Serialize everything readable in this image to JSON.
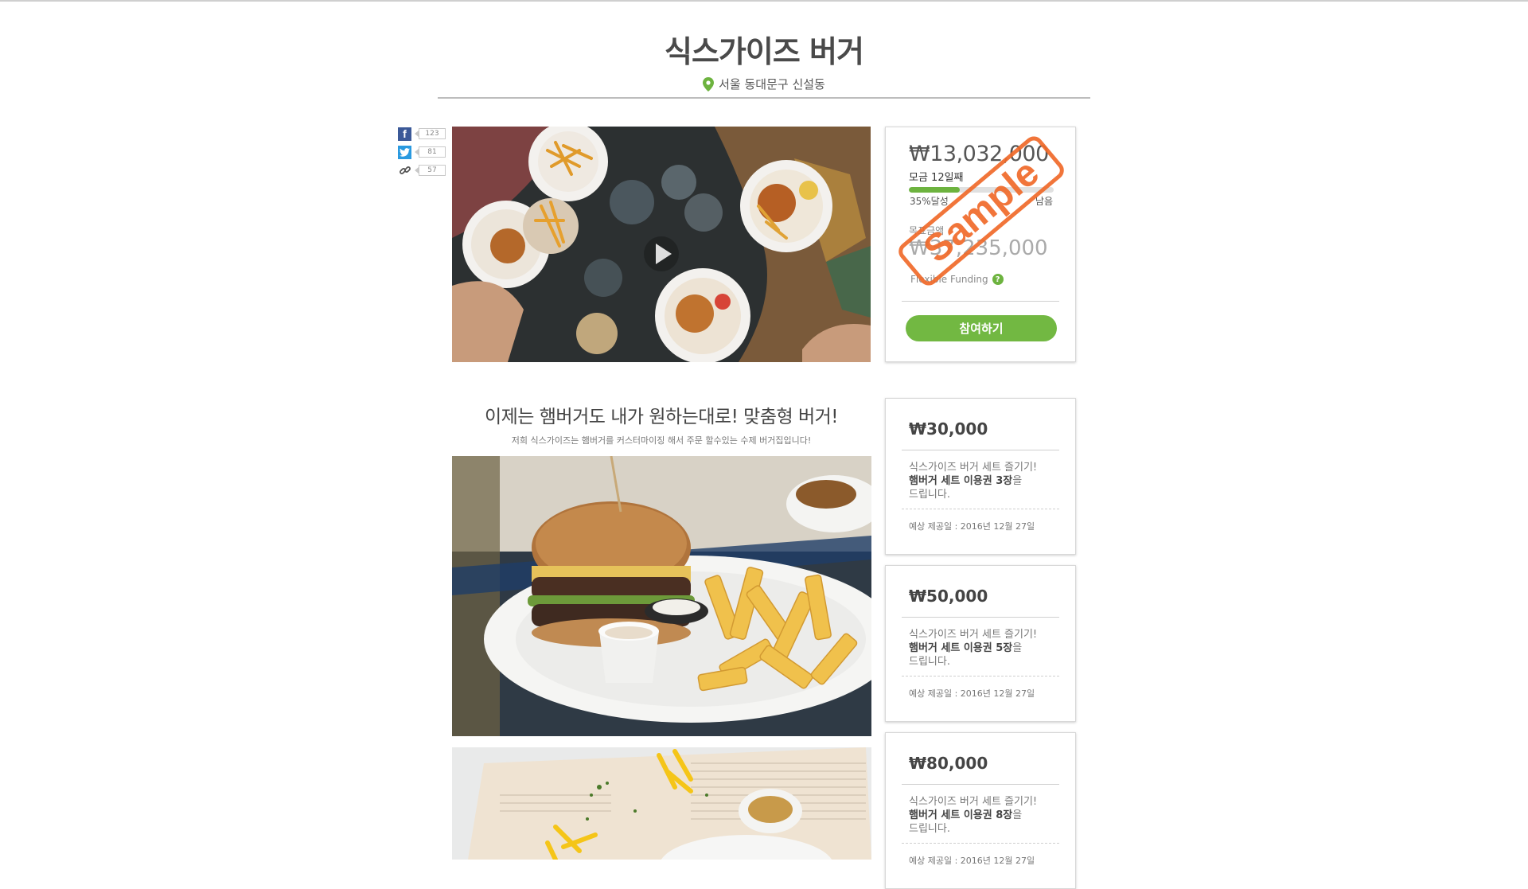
{
  "project": {
    "title": "식스가이즈 버거",
    "location": "서울 동대문구 신설동"
  },
  "social": [
    {
      "icon": "facebook-icon",
      "count": "123"
    },
    {
      "icon": "twitter-icon",
      "count": "81"
    },
    {
      "icon": "link-icon",
      "count": "57"
    }
  ],
  "funding": {
    "amount": "₩13,032,000",
    "days": "모금 12일째",
    "percent_label": "35%달성",
    "progress": 0.35,
    "remaining": "남음",
    "goal_label": "목표금액",
    "goal_amount": "₩37,235,000",
    "funding_type": "Flexible Funding",
    "help_icon": "question-icon",
    "join_label": "참여하기",
    "stamp": "Sample",
    "accent": "#6db33f",
    "stamp_color": "#f06a2a"
  },
  "content": {
    "headline": "이제는 햄버거도 내가 원하는대로! 맞춤형 버거!",
    "description": "저희 식스가이즈는 햄버거를 커스터마이징 해서 주문 할수있는 수제 버거집입니다!"
  },
  "rewards": [
    {
      "price": "₩30,000",
      "line1": "식스가이즈 버거 세트 즐기기!",
      "bold": "햄버거 세트 이용권 3장",
      "rest": "을",
      "line3": "드립니다.",
      "date": "예상 제공일 : 2016년 12월 27일"
    },
    {
      "price": "₩50,000",
      "line1": "식스가이즈 버거 세트 즐기기!",
      "bold": "햄버거 세트 이용권 5장",
      "rest": "을",
      "line3": "드립니다.",
      "date": "예상 제공일 : 2016년 12월 27일"
    },
    {
      "price": "₩80,000",
      "line1": "식스가이즈 버거 세트 즐기기!",
      "bold": "햄버거 세트 이용권 8장",
      "rest": "을",
      "line3": "드립니다.",
      "date": "예상 제공일 : 2016년 12월 27일"
    }
  ]
}
